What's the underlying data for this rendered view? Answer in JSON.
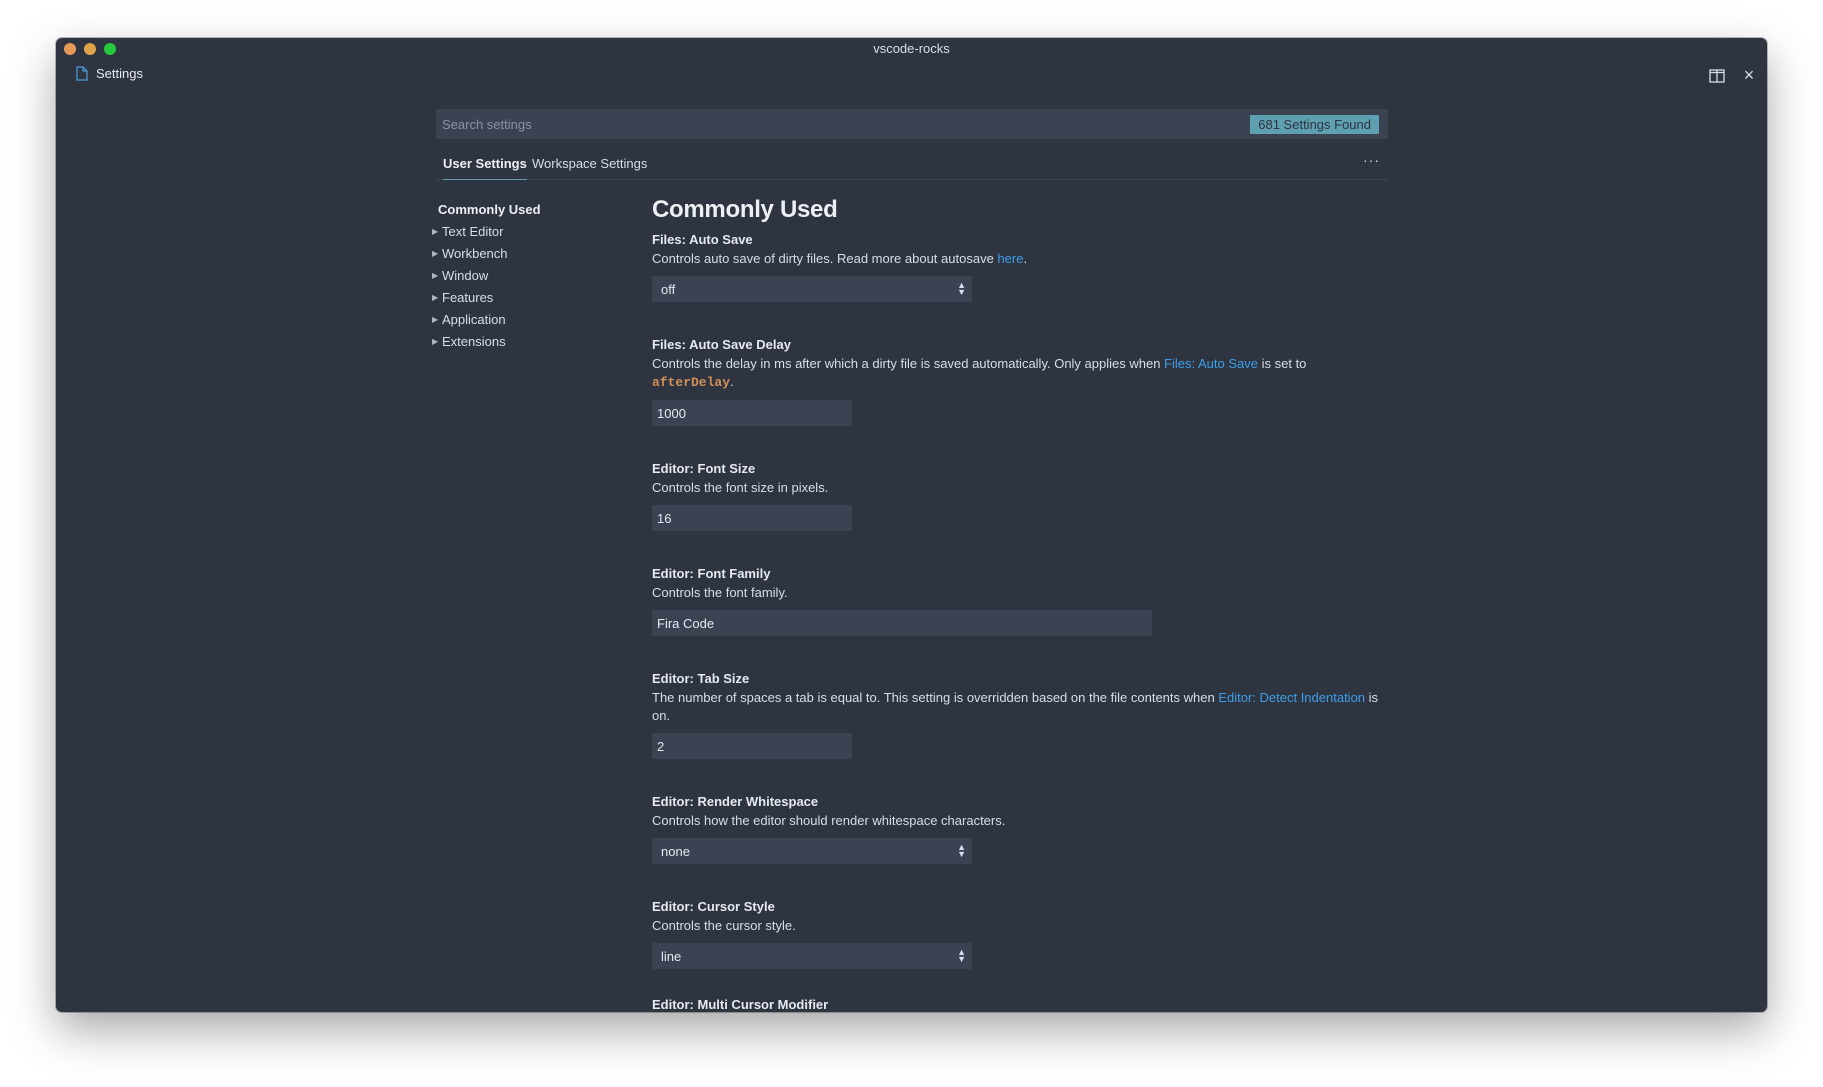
{
  "window": {
    "title": "vscode-rocks"
  },
  "editor_tab": {
    "label": "Settings",
    "icon": "file-icon"
  },
  "search": {
    "placeholder": "Search settings",
    "count": "681 Settings Found"
  },
  "tabs": [
    {
      "label": "User Settings",
      "active": true
    },
    {
      "label": "Workspace Settings",
      "active": false
    }
  ],
  "more": "···",
  "toc": {
    "active": "Commonly Used",
    "items": [
      "Text Editor",
      "Workbench",
      "Window",
      "Features",
      "Application",
      "Extensions"
    ]
  },
  "section_title": "Commonly Used",
  "settings": {
    "auto_save": {
      "category": "Files: ",
      "name": "Auto Save",
      "desc": "Controls auto save of dirty files. Read more about autosave ",
      "link": "here",
      "desc_end": ".",
      "value": "off"
    },
    "auto_save_delay": {
      "category": "Files: ",
      "name": "Auto Save Delay",
      "desc": "Controls the delay in ms after which a dirty file is saved automatically. Only applies when ",
      "link": "Files: Auto Save",
      "desc_mid": " is set to ",
      "code": "afterDelay",
      "desc_end": ".",
      "value": "1000"
    },
    "font_size": {
      "category": "Editor: ",
      "name": "Font Size",
      "desc": "Controls the font size in pixels.",
      "value": "16"
    },
    "font_family": {
      "category": "Editor: ",
      "name": "Font Family",
      "desc": "Controls the font family.",
      "value": "Fira Code"
    },
    "tab_size": {
      "category": "Editor: ",
      "name": "Tab Size",
      "desc": "The number of spaces a tab is equal to. This setting is overridden based on the file contents when ",
      "link": "Editor: Detect Indentation",
      "desc_end": " is on.",
      "value": "2"
    },
    "render_whitespace": {
      "category": "Editor: ",
      "name": "Render Whitespace",
      "desc": "Controls how the editor should render whitespace characters.",
      "value": "none"
    },
    "cursor_style": {
      "category": "Editor: ",
      "name": "Cursor Style",
      "desc": "Controls the cursor style.",
      "value": "line"
    },
    "multi_cursor": {
      "category": "Editor: ",
      "name": "Multi Cursor Modifier"
    }
  },
  "colors": {
    "background": "#2e3440",
    "input_bg": "#3b4252",
    "accent": "#5e9fb0",
    "link": "#3d9ee8",
    "modified_bar": "#3d8ec9",
    "code": "#d08f56"
  }
}
